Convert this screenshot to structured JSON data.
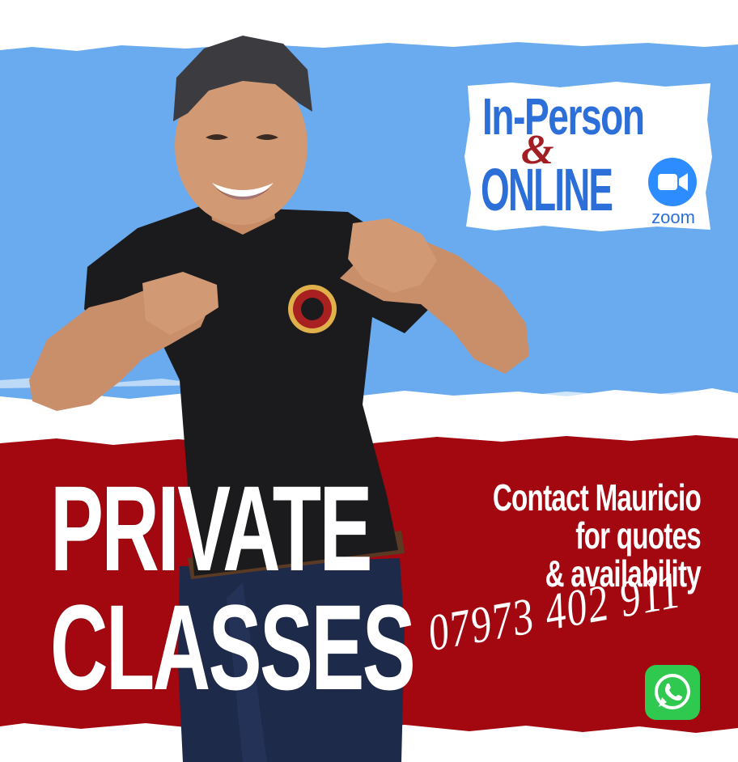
{
  "badge": {
    "line1": "In-Person",
    "ampersand": "&",
    "line2": "ONLINE",
    "zoom_label": "zoom"
  },
  "headline": {
    "line1": "PRIVATE",
    "line2": "CLASSES"
  },
  "contact": {
    "line1": "Contact Mauricio",
    "line2": "for quotes",
    "line3": "& availability",
    "phone": "07973 402 911"
  },
  "icons": {
    "zoom": "zoom-camera-icon",
    "whatsapp": "whatsapp-icon"
  },
  "colors": {
    "blue_stripe": "#6aabef",
    "red_stripe": "#a3070f",
    "badge_text_blue": "#2d6fd9",
    "ampersand_red": "#a31e22",
    "whatsapp_green": "#2fc94f"
  }
}
